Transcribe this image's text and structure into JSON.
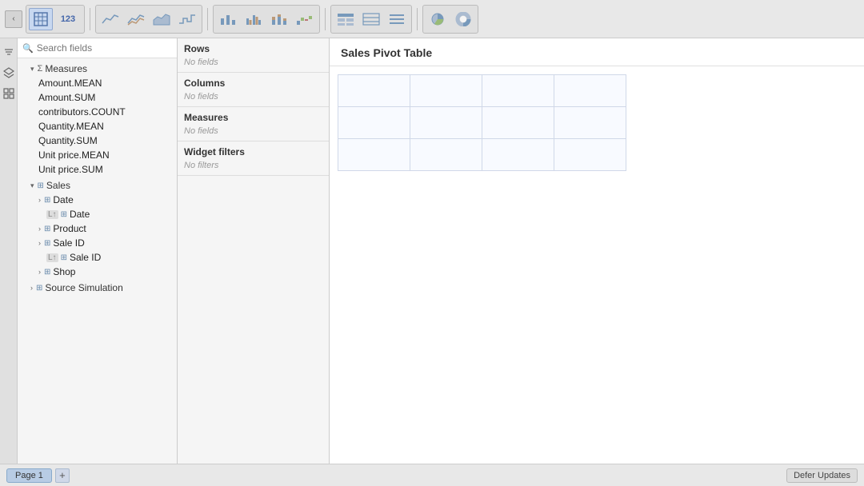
{
  "toolbar": {
    "nav_back": "‹",
    "nav_forward": "›",
    "table_icon": "⊞",
    "number_label": "123",
    "chart_types": [
      "line1",
      "line2",
      "line3",
      "line4",
      "bar1",
      "bar2",
      "bar3",
      "bar4",
      "layout1",
      "layout2",
      "layout3",
      "pie",
      "donut"
    ],
    "page_layout": "≡"
  },
  "sidebar": {
    "search_placeholder": "Search fields",
    "tree": {
      "measures_label": "Measures",
      "measures_items": [
        "Amount.MEAN",
        "Amount.SUM",
        "contributors.COUNT",
        "Quantity.MEAN",
        "Quantity.SUM",
        "Unit price.MEAN",
        "Unit price.SUM"
      ],
      "sales_label": "Sales",
      "date_label": "Date",
      "date_sub": "Date",
      "product_label": "Product",
      "sale_id_label": "Sale ID",
      "sale_id_sub": "Sale ID",
      "shop_label": "Shop",
      "source_label": "Source Simulation"
    }
  },
  "config": {
    "rows_title": "Rows",
    "rows_empty": "No fields",
    "columns_title": "Columns",
    "columns_empty": "No fields",
    "measures_title": "Measures",
    "measures_empty": "No fields",
    "filters_title": "Widget filters",
    "filters_empty": "No filters"
  },
  "pivot": {
    "title": "Sales Pivot Table"
  },
  "bottom": {
    "page1": "Page 1",
    "add_page": "+",
    "defer": "Defer Updates"
  }
}
